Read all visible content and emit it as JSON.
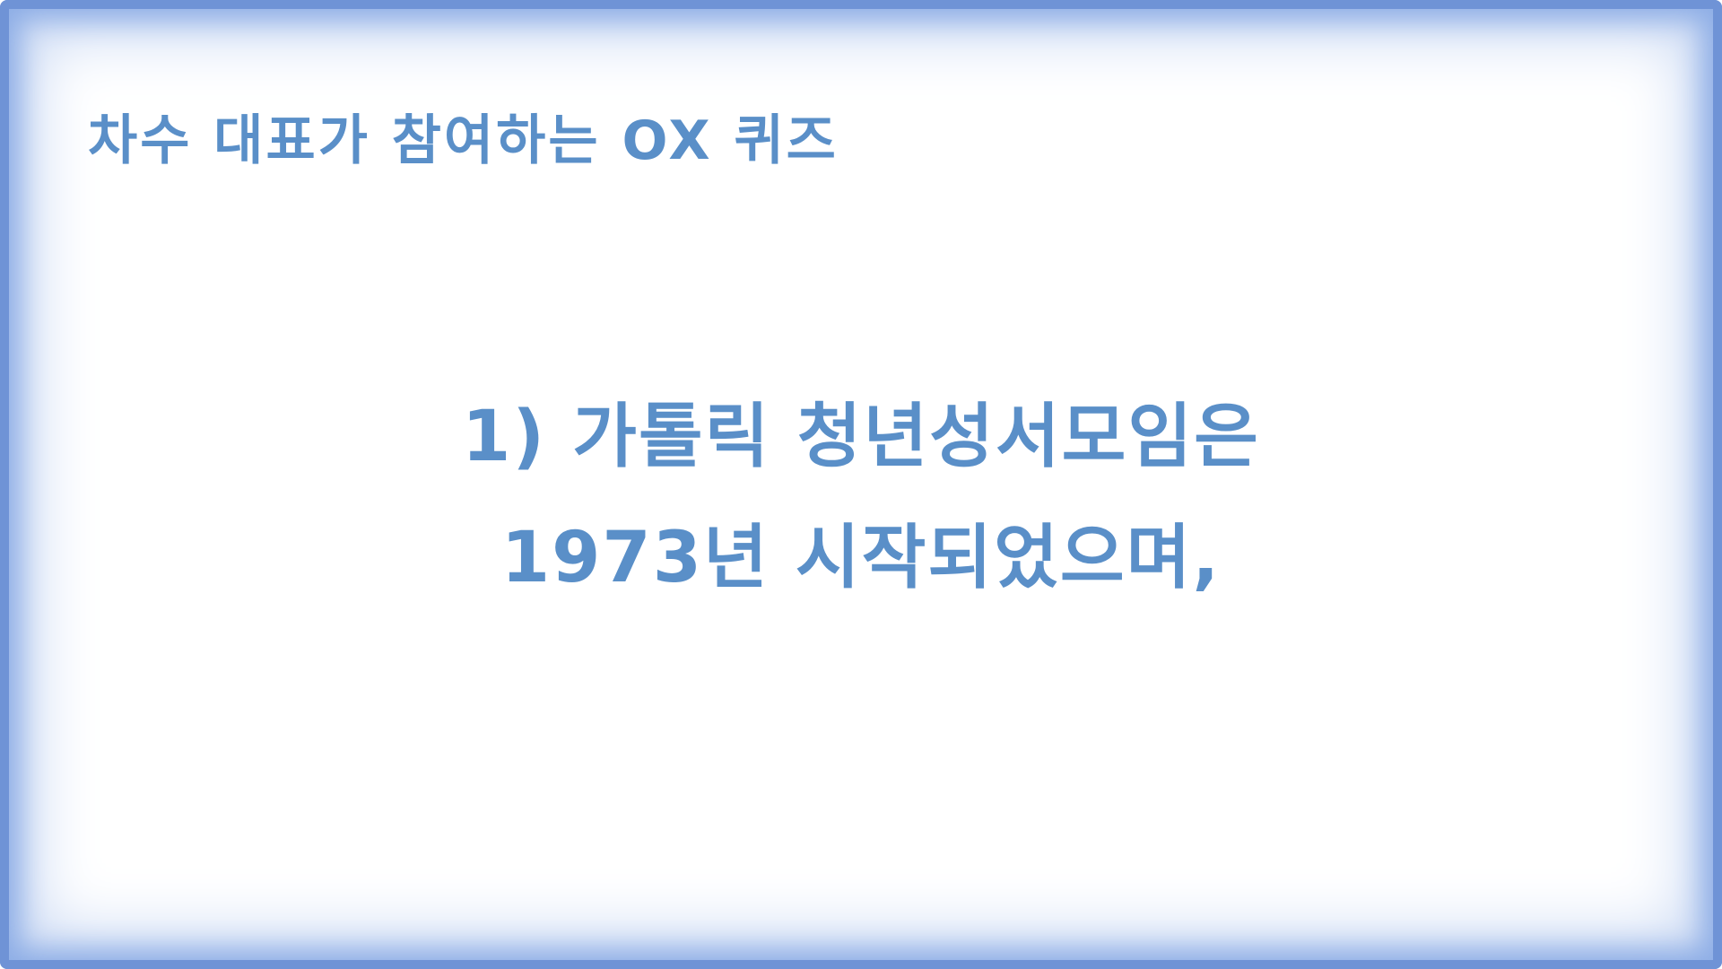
{
  "slide": {
    "title": "차수 대표가 참여하는 OX 퀴즈",
    "question_lines": [
      "1) 가톨릭 청년성서모임은",
      "1973년 시작되었으며,"
    ]
  },
  "colors": {
    "text": "#5a8fc8",
    "frame": "#6f93d6",
    "background": "#ffffff"
  }
}
